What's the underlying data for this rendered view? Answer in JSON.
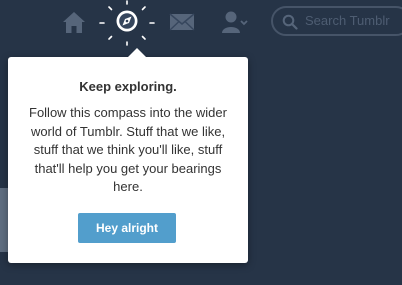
{
  "nav": {
    "icons": [
      "home-icon",
      "compass-icon",
      "mail-icon",
      "account-icon",
      "search-icon"
    ],
    "search_placeholder": "Search Tumblr"
  },
  "popover": {
    "title": "Keep exploring.",
    "body": "Follow this compass into the wider world of Tumblr. Stuff that we like, stuff that we think you'll like, stuff that'll help you get your bearings here.",
    "button_label": "Hey alright"
  },
  "colors": {
    "background": "#36465d",
    "button": "#529ecc",
    "popover": "#ffffff"
  }
}
